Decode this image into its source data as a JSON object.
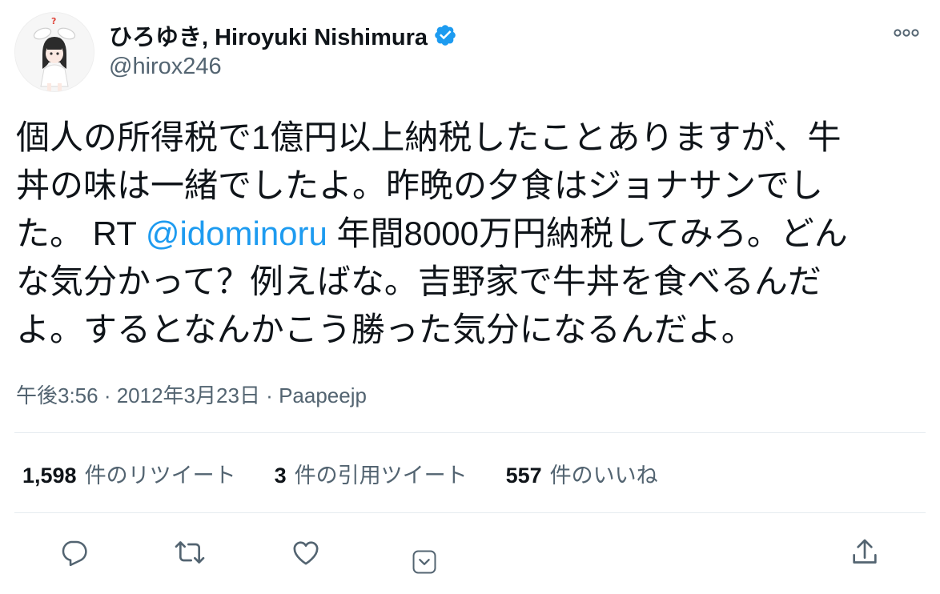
{
  "author": {
    "display_name": "ひろゆき, Hiroyuki Nishimura",
    "handle": "@hirox246",
    "verified": true
  },
  "tweet": {
    "lines": [
      {
        "pre": "個人の所得税で1億円以上納税したことありますが、牛"
      },
      {
        "pre": "丼の味は一緒でしたよ。昨晩の夕食はジョナサンでし"
      },
      {
        "pre": "た。 RT ",
        "mention": "@idominoru",
        "post": " 年間8000万円納税してみろ。どん"
      },
      {
        "pre": "な気分かって？例えばな。吉野家で牛丼を食べるんだ"
      },
      {
        "pre": "よ。するとなんかこう勝った気分になるんだよ。"
      }
    ]
  },
  "meta": {
    "time": "午後3:56",
    "separator": " · ",
    "date": "2012年3月23日",
    "source": "Paapeejp"
  },
  "stats": {
    "retweets": {
      "count": "1,598",
      "label": "件のリツイート"
    },
    "quotes": {
      "count": "3",
      "label": "件の引用ツイート"
    },
    "likes": {
      "count": "557",
      "label": "件のいいね"
    }
  },
  "actions": {
    "reply": "reply-icon",
    "retweet": "retweet-icon",
    "like": "heart-icon",
    "more_actions": "chevron-down-box-icon",
    "share": "share-icon"
  },
  "colors": {
    "accent": "#1d9bf0",
    "text": "#0f1419",
    "secondary": "#536471",
    "divider": "#e6ecf0"
  }
}
